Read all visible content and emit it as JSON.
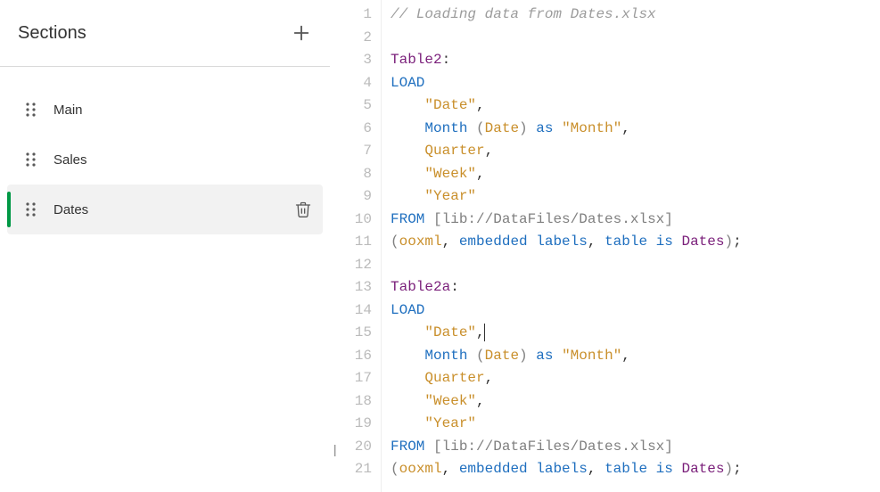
{
  "sidebar": {
    "title": "Sections",
    "items": [
      {
        "label": "Main",
        "active": false
      },
      {
        "label": "Sales",
        "active": false
      },
      {
        "label": "Dates",
        "active": true
      }
    ]
  },
  "editor": {
    "lines": [
      {
        "n": 1,
        "tokens": [
          {
            "t": "// Loading data from Dates.xlsx",
            "c": "tok-comment"
          }
        ]
      },
      {
        "n": 2,
        "tokens": [
          {
            "t": "",
            "c": ""
          }
        ]
      },
      {
        "n": 3,
        "tokens": [
          {
            "t": "Table2",
            "c": "tok-tname"
          },
          {
            "t": ":",
            "c": ""
          }
        ]
      },
      {
        "n": 4,
        "tokens": [
          {
            "t": "LOAD",
            "c": "tok-kw"
          }
        ]
      },
      {
        "n": 5,
        "tokens": [
          {
            "t": "    ",
            "c": ""
          },
          {
            "t": "\"Date\"",
            "c": "tok-str"
          },
          {
            "t": ",",
            "c": ""
          }
        ]
      },
      {
        "n": 6,
        "tokens": [
          {
            "t": "    ",
            "c": ""
          },
          {
            "t": "Month",
            "c": "tok-kw"
          },
          {
            "t": " ",
            "c": ""
          },
          {
            "t": "(",
            "c": "tok-op"
          },
          {
            "t": "Date",
            "c": "tok-ident"
          },
          {
            "t": ")",
            "c": "tok-op"
          },
          {
            "t": " ",
            "c": ""
          },
          {
            "t": "as",
            "c": "tok-kw"
          },
          {
            "t": " ",
            "c": ""
          },
          {
            "t": "\"Month\"",
            "c": "tok-str"
          },
          {
            "t": ",",
            "c": ""
          }
        ]
      },
      {
        "n": 7,
        "tokens": [
          {
            "t": "    ",
            "c": ""
          },
          {
            "t": "Quarter",
            "c": "tok-ident"
          },
          {
            "t": ",",
            "c": ""
          }
        ]
      },
      {
        "n": 8,
        "tokens": [
          {
            "t": "    ",
            "c": ""
          },
          {
            "t": "\"Week\"",
            "c": "tok-str"
          },
          {
            "t": ",",
            "c": ""
          }
        ]
      },
      {
        "n": 9,
        "tokens": [
          {
            "t": "    ",
            "c": ""
          },
          {
            "t": "\"Year\"",
            "c": "tok-str"
          }
        ]
      },
      {
        "n": 10,
        "tokens": [
          {
            "t": "FROM",
            "c": "tok-kw"
          },
          {
            "t": " ",
            "c": ""
          },
          {
            "t": "[",
            "c": "tok-op"
          },
          {
            "t": "lib://DataFiles/Dates.xlsx",
            "c": "tok-dim"
          },
          {
            "t": "]",
            "c": "tok-op"
          }
        ]
      },
      {
        "n": 11,
        "tokens": [
          {
            "t": "(",
            "c": "tok-op"
          },
          {
            "t": "ooxml",
            "c": "tok-ident"
          },
          {
            "t": ", ",
            "c": ""
          },
          {
            "t": "embedded labels",
            "c": "tok-kw"
          },
          {
            "t": ", ",
            "c": ""
          },
          {
            "t": "table is",
            "c": "tok-kw"
          },
          {
            "t": " ",
            "c": ""
          },
          {
            "t": "Dates",
            "c": "tok-tname"
          },
          {
            "t": ")",
            "c": "tok-op"
          },
          {
            "t": ";",
            "c": ""
          }
        ]
      },
      {
        "n": 12,
        "tokens": [
          {
            "t": "",
            "c": ""
          }
        ]
      },
      {
        "n": 13,
        "tokens": [
          {
            "t": "Table2a",
            "c": "tok-tname"
          },
          {
            "t": ":",
            "c": ""
          }
        ]
      },
      {
        "n": 14,
        "tokens": [
          {
            "t": "LOAD",
            "c": "tok-kw"
          }
        ]
      },
      {
        "n": 15,
        "tokens": [
          {
            "t": "    ",
            "c": ""
          },
          {
            "t": "\"Date\"",
            "c": "tok-str"
          },
          {
            "t": ",",
            "c": ""
          }
        ],
        "cursorAfter": true
      },
      {
        "n": 16,
        "tokens": [
          {
            "t": "    ",
            "c": ""
          },
          {
            "t": "Month",
            "c": "tok-kw"
          },
          {
            "t": " ",
            "c": ""
          },
          {
            "t": "(",
            "c": "tok-op"
          },
          {
            "t": "Date",
            "c": "tok-ident"
          },
          {
            "t": ")",
            "c": "tok-op"
          },
          {
            "t": " ",
            "c": ""
          },
          {
            "t": "as",
            "c": "tok-kw"
          },
          {
            "t": " ",
            "c": ""
          },
          {
            "t": "\"Month\"",
            "c": "tok-str"
          },
          {
            "t": ",",
            "c": ""
          }
        ]
      },
      {
        "n": 17,
        "tokens": [
          {
            "t": "    ",
            "c": ""
          },
          {
            "t": "Quarter",
            "c": "tok-ident"
          },
          {
            "t": ",",
            "c": ""
          }
        ]
      },
      {
        "n": 18,
        "tokens": [
          {
            "t": "    ",
            "c": ""
          },
          {
            "t": "\"Week\"",
            "c": "tok-str"
          },
          {
            "t": ",",
            "c": ""
          }
        ]
      },
      {
        "n": 19,
        "tokens": [
          {
            "t": "    ",
            "c": ""
          },
          {
            "t": "\"Year\"",
            "c": "tok-str"
          }
        ]
      },
      {
        "n": 20,
        "tokens": [
          {
            "t": "FROM",
            "c": "tok-kw"
          },
          {
            "t": " ",
            "c": ""
          },
          {
            "t": "[",
            "c": "tok-op"
          },
          {
            "t": "lib://DataFiles/Dates.xlsx",
            "c": "tok-dim"
          },
          {
            "t": "]",
            "c": "tok-op"
          }
        ]
      },
      {
        "n": 21,
        "tokens": [
          {
            "t": "(",
            "c": "tok-op"
          },
          {
            "t": "ooxml",
            "c": "tok-ident"
          },
          {
            "t": ", ",
            "c": ""
          },
          {
            "t": "embedded labels",
            "c": "tok-kw"
          },
          {
            "t": ", ",
            "c": ""
          },
          {
            "t": "table is",
            "c": "tok-kw"
          },
          {
            "t": " ",
            "c": ""
          },
          {
            "t": "Dates",
            "c": "tok-tname"
          },
          {
            "t": ")",
            "c": "tok-op"
          },
          {
            "t": ";",
            "c": ""
          }
        ]
      }
    ]
  }
}
